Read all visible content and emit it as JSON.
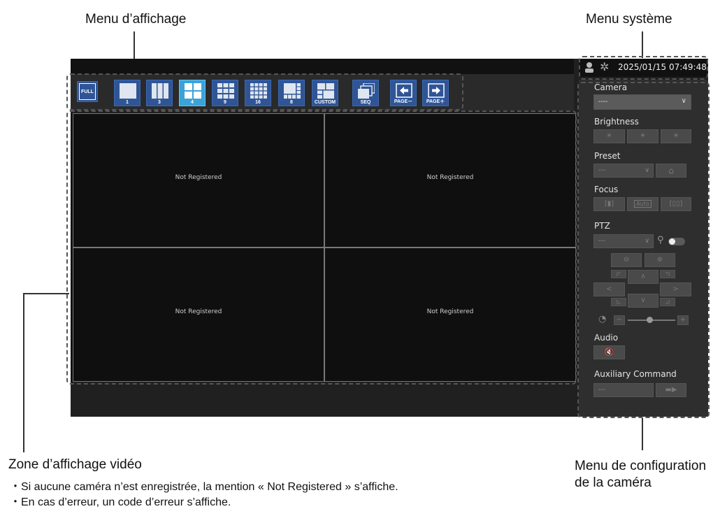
{
  "callouts": {
    "display_menu": "Menu d’affichage",
    "system_menu": "Menu système",
    "video_area": "Zone d’affichage vidéo",
    "camera_menu_line1": "Menu de configuration",
    "camera_menu_line2": "de la caméra"
  },
  "notes": [
    "・Si aucune caméra n’est enregistrée, la mention « Not Registered » s’affiche.",
    "・En cas d’erreur, un code d’erreur s’affiche."
  ],
  "system": {
    "datetime": "2025/01/15 07:49:48"
  },
  "toolbar": {
    "buttons": [
      {
        "label": "FULL",
        "icon": "full-screen-icon"
      },
      {
        "label": "1",
        "icon": "layout-1-icon"
      },
      {
        "label": "3",
        "icon": "layout-3-icon"
      },
      {
        "label": "4",
        "icon": "layout-4-icon",
        "active": true
      },
      {
        "label": "9",
        "icon": "layout-9-icon"
      },
      {
        "label": "16",
        "icon": "layout-16-icon"
      },
      {
        "label": "8",
        "icon": "layout-8-icon"
      },
      {
        "label": "CUSTOM",
        "icon": "layout-custom-icon"
      },
      {
        "label": "SEQ",
        "icon": "sequence-icon"
      },
      {
        "label": "PAGE－",
        "icon": "arrow-left-icon"
      },
      {
        "label": "PAGE＋",
        "icon": "arrow-right-icon"
      }
    ]
  },
  "video": {
    "cells": [
      "Not Registered",
      "Not Registered",
      "Not Registered",
      "Not Registered"
    ]
  },
  "camera_panel": {
    "camera_label": "Camera",
    "camera_value": "----",
    "brightness_label": "Brightness",
    "preset_label": "Preset",
    "preset_value": "---",
    "focus_label": "Focus",
    "focus_auto": "Auto",
    "ptz_label": "PTZ",
    "ptz_value": "---",
    "audio_label": "Audio",
    "aux_label": "Auxiliary Command",
    "aux_value": "---"
  },
  "colors": {
    "accent": "#2f5597",
    "active": "#3aa3d8"
  }
}
